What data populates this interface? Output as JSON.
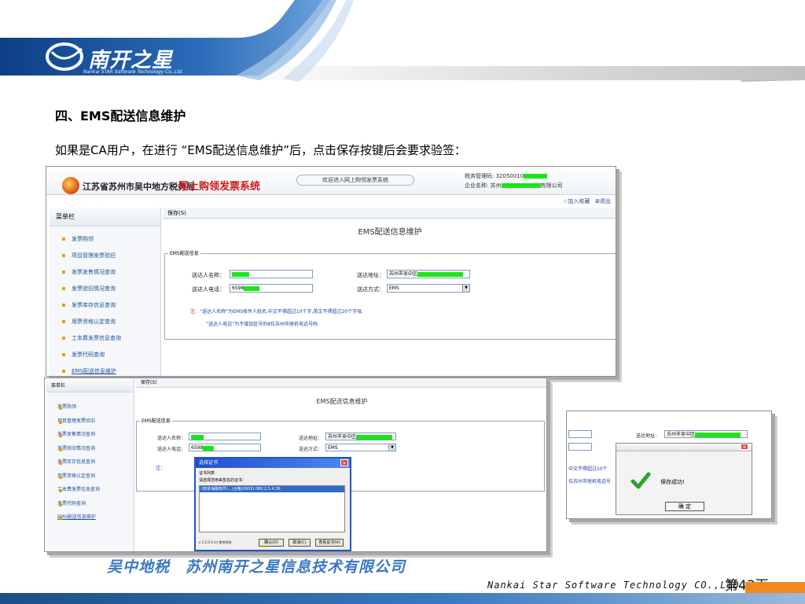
{
  "header": {
    "logo_text": "南开之星",
    "logo_sub": "Nankai STAR Software Technology Co.,Ltd."
  },
  "slide": {
    "title": "四、EMS配送信息维护",
    "body": "如果是CA用户，在进行 “EMS配送信息维护”后，点击保存按键后会要求验签："
  },
  "shot1": {
    "bureau": "江苏省苏州市吴中地方税务局",
    "system_name": "网上购领发票系统",
    "welcome": "欢迎进入网上购领发票系统",
    "tax_code_label": "税务管理码: 32050010",
    "company_label": "企业名称:",
    "company_prefix": "苏州",
    "company_suffix": "有限公司",
    "link_favorite": "☆加入收藏",
    "link_exit": "⊠退出",
    "menu_title": "菜单栏",
    "save_label": "保存(S)",
    "form_title": "EMS配送信息维护",
    "fieldset_legend": "EMS配送信息",
    "recipient_name_label": "送达人名称：",
    "recipient_phone_label": "送达人电话：",
    "phone_value": "6598",
    "address_label": "送达地址：",
    "address_value": "苏州市吴中区",
    "method_label": "送达方式：",
    "method_value": "EMS",
    "note_prefix": "注：",
    "note_line1": "“送达人名称”为EMS收件人姓名,中文不得超过10个字,英文不得超过20个字母.",
    "note_line2": "“送达人电话”为不增加区号的8位苏州市座机电话号码."
  },
  "sidebar": {
    "items": [
      "发票购领",
      "项目管理发票验旧",
      "发票发售情况查询",
      "发票验旧情况查询",
      "发票库存信息查询",
      "用票资格认定查询",
      "工本费发票信息查询",
      "发票代码查询",
      "EMS配送信息维护"
    ]
  },
  "cert_dialog": {
    "title": "选择证书",
    "subtitle": "证书列表",
    "hint": "请选择您用来签名的证书：",
    "row_text": "(南京海融软件)...(合格)0003) 080.2.5.4.36",
    "version": "v 2.1.0.3 (c) 南京科技",
    "ok": "确认(O)",
    "cancel": "取消(C)",
    "view": "查看证书(V)"
  },
  "success": {
    "address_label": "送达地址：",
    "address_value": "苏州市吴中区",
    "side_text1": "中文不得超过10个",
    "side_text2": "位苏州市座机电话号",
    "message": "保存成功!",
    "ok": "确 定"
  },
  "footer": {
    "company": "吴中地税　苏州南开之星信息技术有限公司",
    "english": "Nankai Star Software Technology CO.,LTD.",
    "page_prefix": "第",
    "page_number": "43",
    "page_suffix": "页"
  }
}
